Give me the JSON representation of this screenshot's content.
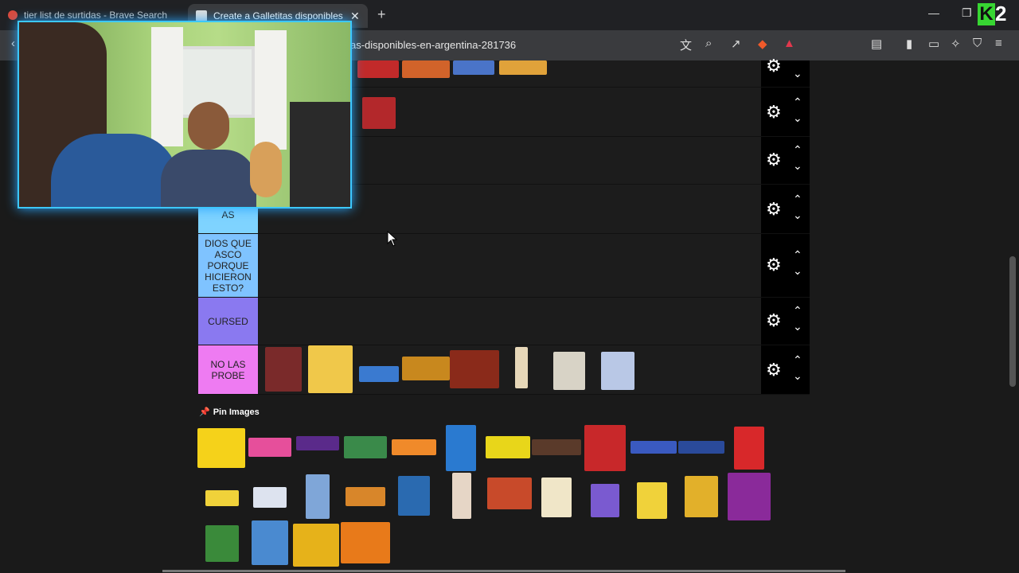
{
  "tabs": [
    {
      "title": "tier list de surtidas - Brave Search"
    },
    {
      "title": "Create a Galletitas disponibles en"
    }
  ],
  "address": {
    "url": "as-disponibles-en-argentina-281736"
  },
  "tiers": [
    {
      "label": "",
      "color": "#000000"
    },
    {
      "label": "",
      "color": "#000000"
    },
    {
      "label": "",
      "color": "#000000"
    },
    {
      "label": "AS",
      "color": "#7fd3ff"
    },
    {
      "label": "DIOS QUE ASCO PORQUE HICIERON ESTO?",
      "color": "#7fc3ff"
    },
    {
      "label": "CURSED",
      "color": "#8a79f0"
    },
    {
      "label": "NO LAS PROBE",
      "color": "#ee7bf2"
    }
  ],
  "pin_images": {
    "title": "Pin Images"
  },
  "colors": {
    "tabbar": "#202124",
    "toolbar": "#3a3b3e",
    "page": "#1a1a1a",
    "webcam_border": "#3cc8ff",
    "brand_k": "#37d632"
  }
}
